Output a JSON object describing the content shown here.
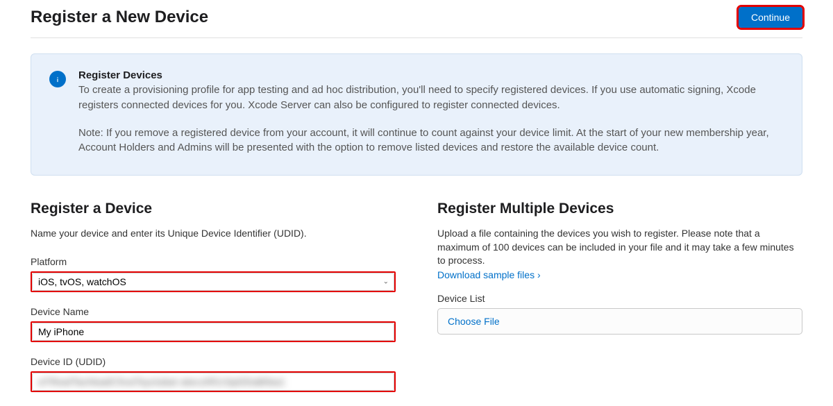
{
  "header": {
    "title": "Register a New Device",
    "continue_label": "Continue"
  },
  "info": {
    "title": "Register Devices",
    "para1": "To create a provisioning profile for app testing and ad hoc distribution, you'll need to specify registered devices. If you use automatic signing, Xcode registers connected devices for you. Xcode Server can also be configured to register connected devices.",
    "para2": "Note: If you remove a registered device from your account, it will continue to count against your device limit. At the start of your new membership year, Account Holders and Admins will be presented with the option to remove listed devices and restore the available device count."
  },
  "single": {
    "title": "Register a Device",
    "desc": "Name your device and enter its Unique Device Identifier (UDID).",
    "platform_label": "Platform",
    "platform_value": "iOS, tvOS, watchOS",
    "device_name_label": "Device Name",
    "device_name_value": "My iPhone",
    "device_id_label": "Device ID (UDID)",
    "device_id_masked": "aTRealTachkadC5vaTsyclubal atecztfG1SpDDaBIba1"
  },
  "multiple": {
    "title": "Register Multiple Devices",
    "desc": "Upload a file containing the devices you wish to register. Please note that a maximum of 100 devices can be included in your file and it may take a few minutes to process.",
    "download_link": "Download sample files",
    "device_list_label": "Device List",
    "choose_file_label": "Choose File"
  }
}
